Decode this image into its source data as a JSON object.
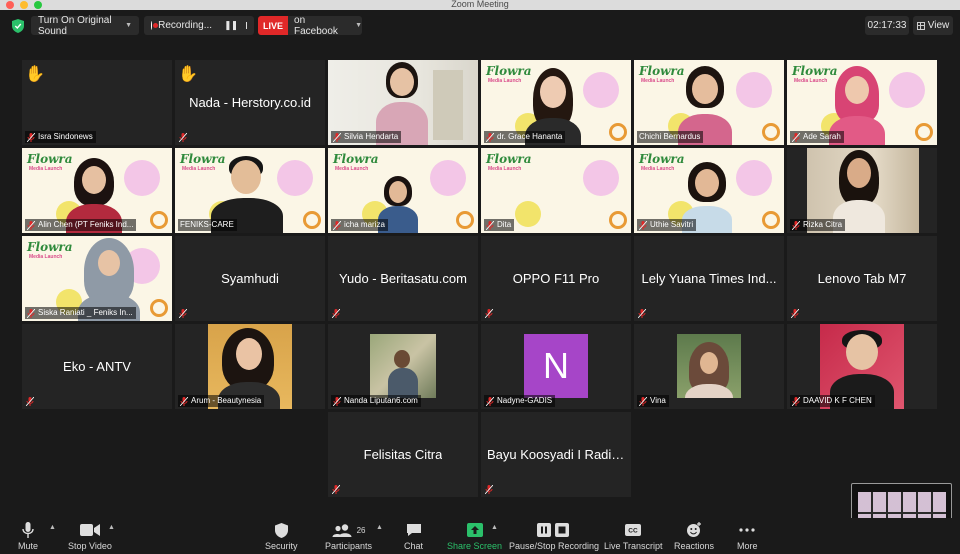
{
  "window": {
    "title": "Zoom Meeting"
  },
  "topbar": {
    "original_sound": "Turn On Original Sound",
    "recording": "Recording...",
    "live_badge": "LIVE",
    "live_target": "on Facebook",
    "timer": "02:17:33",
    "view": "View"
  },
  "participants": [
    {
      "name": "Isra Sindonews"
    },
    {
      "name": "Nada - Herstory.co.id"
    },
    {
      "name": "Silvia Hendarta"
    },
    {
      "name": "dr. Grace Hananta"
    },
    {
      "name": "Chichi Bernardus"
    },
    {
      "name": "Ade Sarah"
    },
    {
      "name": "Alin Chen (PT Feniks Ind..."
    },
    {
      "name": "FENIKS-CARE"
    },
    {
      "name": "icha mariza"
    },
    {
      "name": "Dita"
    },
    {
      "name": "Uthie Savitri"
    },
    {
      "name": "Rizka Citra"
    },
    {
      "name": "Siska Raniati _ Feniks In..."
    },
    {
      "name": "Syamhudi"
    },
    {
      "name": "Yudo - Beritasatu.com"
    },
    {
      "name": "OPPO F11 Pro"
    },
    {
      "name": "Lely Yuana Times Ind..."
    },
    {
      "name": "Lenovo Tab M7"
    },
    {
      "name": "Eko  - ANTV"
    },
    {
      "name": "Arum - Beautynesia"
    },
    {
      "name": "Nanda Liputan6.com"
    },
    {
      "name": "Nadyne-GADIS"
    },
    {
      "name": "Vina"
    },
    {
      "name": "DAAVID K F CHEN"
    },
    {
      "name": "Felisitas Citra"
    },
    {
      "name": "Bayu Koosyadi I Radio..."
    }
  ],
  "avatar_letter": "N",
  "slide": {
    "brand": "Flowra",
    "subtitle": "Media Launch"
  },
  "toolbar": {
    "mute": "Mute",
    "stop_video": "Stop Video",
    "security": "Security",
    "participants": "Participants",
    "participants_count": "26",
    "chat": "Chat",
    "share_screen": "Share Screen",
    "pause_stop_recording": "Pause/Stop Recording",
    "live_transcript": "Live Transcript",
    "reactions": "Reactions",
    "more": "More"
  },
  "colors": {
    "live_red": "#e02828",
    "share_green": "#2bc06a",
    "active_speaker": "#c6e266",
    "avatar_purple": "#a645c8"
  }
}
